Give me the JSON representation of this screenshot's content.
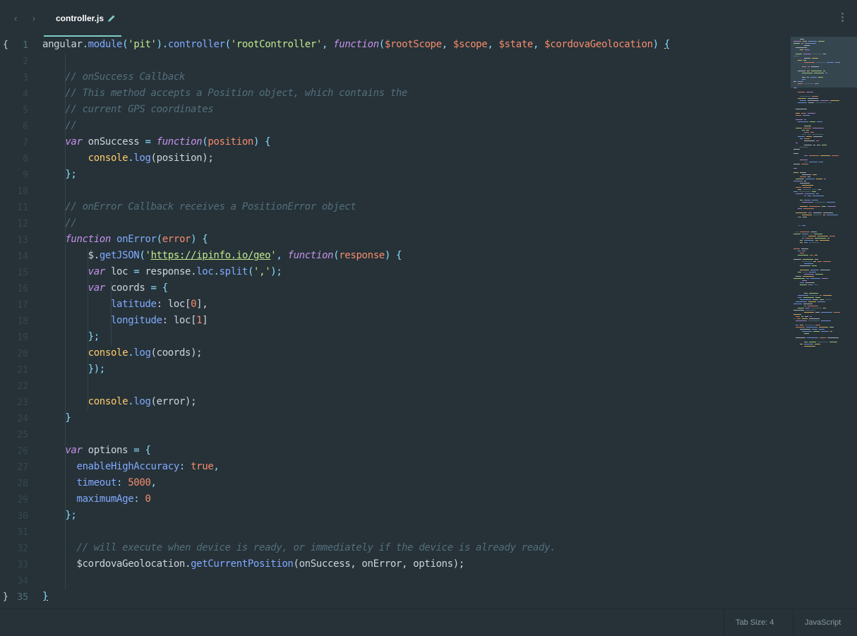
{
  "tab": {
    "filename": "controller.js"
  },
  "status": {
    "tab_size": "Tab Size: 4",
    "syntax": "JavaScript"
  },
  "colors": {
    "background": "#263238",
    "accent": "#80cbc4",
    "keyword": "#c792ea",
    "function": "#82aaff",
    "string": "#c3e88d",
    "comment": "#546e7a",
    "number": "#f78c6c",
    "constant": "#ffcb6b"
  },
  "icons": {
    "back": "chevron-left-icon",
    "forward": "chevron-right-icon",
    "edited": "pencil-icon",
    "menu": "more-vertical-icon"
  },
  "lines": [
    {
      "n": "1",
      "fold": "{",
      "t": [
        [
          "angular",
          "v"
        ],
        [
          ".",
          "p"
        ],
        [
          "module",
          "f"
        ],
        [
          "(",
          "p"
        ],
        [
          "'pit'",
          "s"
        ],
        [
          ")",
          "p"
        ],
        [
          ".",
          "p"
        ],
        [
          "controller",
          "f"
        ],
        [
          "(",
          "p"
        ],
        [
          "'rootController'",
          "s"
        ],
        [
          ", ",
          "p"
        ],
        [
          "function",
          "k"
        ],
        [
          "(",
          "p"
        ],
        [
          "$rootScope",
          "a"
        ],
        [
          ", ",
          "p"
        ],
        [
          "$scope",
          "a"
        ],
        [
          ", ",
          "p"
        ],
        [
          "$state",
          "a"
        ],
        [
          ", ",
          "p"
        ],
        [
          "$cordovaGeolocation",
          "a"
        ],
        [
          ") ",
          "p"
        ],
        [
          "{",
          "h"
        ]
      ]
    },
    {
      "n": "2",
      "t": []
    },
    {
      "n": "3",
      "t": [
        [
          "    ",
          "p"
        ],
        [
          "// onSuccess Callback",
          "c"
        ]
      ]
    },
    {
      "n": "4",
      "t": [
        [
          "    ",
          "p"
        ],
        [
          "// This method accepts a Position object, which contains the",
          "c"
        ]
      ]
    },
    {
      "n": "5",
      "t": [
        [
          "    ",
          "p"
        ],
        [
          "// current GPS coordinates",
          "c"
        ]
      ]
    },
    {
      "n": "6",
      "t": [
        [
          "    ",
          "p"
        ],
        [
          "//",
          "c"
        ]
      ]
    },
    {
      "n": "7",
      "t": [
        [
          "    ",
          "p"
        ],
        [
          "var",
          "k"
        ],
        [
          " onSuccess ",
          "v"
        ],
        [
          "= ",
          "p"
        ],
        [
          "function",
          "k"
        ],
        [
          "(",
          "p"
        ],
        [
          "position",
          "a"
        ],
        [
          ") {",
          "p"
        ]
      ]
    },
    {
      "n": "8",
      "t": [
        [
          "        ",
          "p"
        ],
        [
          "console",
          "y"
        ],
        [
          ".",
          "p"
        ],
        [
          "log",
          "f"
        ],
        [
          "(position);",
          "v"
        ]
      ]
    },
    {
      "n": "9",
      "t": [
        [
          "    ",
          "p"
        ],
        [
          "};",
          "p"
        ]
      ]
    },
    {
      "n": "10",
      "t": []
    },
    {
      "n": "11",
      "t": [
        [
          "    ",
          "p"
        ],
        [
          "// onError Callback receives a PositionError object",
          "c"
        ]
      ]
    },
    {
      "n": "12",
      "t": [
        [
          "    ",
          "p"
        ],
        [
          "//",
          "c"
        ]
      ]
    },
    {
      "n": "13",
      "t": [
        [
          "    ",
          "p"
        ],
        [
          "function",
          "k"
        ],
        [
          " onError",
          "f"
        ],
        [
          "(",
          "p"
        ],
        [
          "error",
          "a"
        ],
        [
          ") {",
          "p"
        ]
      ]
    },
    {
      "n": "14",
      "t": [
        [
          "        ",
          "p"
        ],
        [
          "$.",
          "v"
        ],
        [
          "getJSON",
          "f"
        ],
        [
          "(",
          "p"
        ],
        [
          "'",
          "s"
        ],
        [
          "https://ipinfo.io/geo",
          "u"
        ],
        [
          "'",
          "s"
        ],
        [
          ", ",
          "p"
        ],
        [
          "function",
          "k"
        ],
        [
          "(",
          "p"
        ],
        [
          "response",
          "a"
        ],
        [
          ") {",
          "p"
        ]
      ]
    },
    {
      "n": "15",
      "t": [
        [
          "        ",
          "p"
        ],
        [
          "var",
          "k"
        ],
        [
          " loc ",
          "v"
        ],
        [
          "= ",
          "p"
        ],
        [
          "response.",
          "v"
        ],
        [
          "loc",
          "f"
        ],
        [
          ".",
          "p"
        ],
        [
          "split",
          "f"
        ],
        [
          "(",
          "p"
        ],
        [
          "','",
          "s"
        ],
        [
          ");",
          "p"
        ]
      ]
    },
    {
      "n": "16",
      "t": [
        [
          "        ",
          "p"
        ],
        [
          "var",
          "k"
        ],
        [
          " coords ",
          "v"
        ],
        [
          "= {",
          "p"
        ]
      ]
    },
    {
      "n": "17",
      "t": [
        [
          "            ",
          "p"
        ],
        [
          "latitude",
          "f"
        ],
        [
          ": loc[",
          "v"
        ],
        [
          "0",
          "n"
        ],
        [
          "],",
          "v"
        ]
      ]
    },
    {
      "n": "18",
      "t": [
        [
          "            ",
          "p"
        ],
        [
          "longitude",
          "f"
        ],
        [
          ": loc[",
          "v"
        ],
        [
          "1",
          "n"
        ],
        [
          "]",
          "v"
        ]
      ]
    },
    {
      "n": "19",
      "t": [
        [
          "        ",
          "p"
        ],
        [
          "};",
          "p"
        ]
      ]
    },
    {
      "n": "20",
      "t": [
        [
          "        ",
          "p"
        ],
        [
          "console",
          "y"
        ],
        [
          ".",
          "p"
        ],
        [
          "log",
          "f"
        ],
        [
          "(coords);",
          "v"
        ]
      ]
    },
    {
      "n": "21",
      "t": [
        [
          "        ",
          "p"
        ],
        [
          "});",
          "p"
        ]
      ]
    },
    {
      "n": "22",
      "t": []
    },
    {
      "n": "23",
      "t": [
        [
          "        ",
          "p"
        ],
        [
          "console",
          "y"
        ],
        [
          ".",
          "p"
        ],
        [
          "log",
          "f"
        ],
        [
          "(error);",
          "v"
        ]
      ]
    },
    {
      "n": "24",
      "t": [
        [
          "    ",
          "p"
        ],
        [
          "}",
          "p"
        ]
      ]
    },
    {
      "n": "25",
      "t": []
    },
    {
      "n": "26",
      "t": [
        [
          "    ",
          "p"
        ],
        [
          "var",
          "k"
        ],
        [
          " options ",
          "v"
        ],
        [
          "= {",
          "p"
        ]
      ]
    },
    {
      "n": "27",
      "t": [
        [
          "      ",
          "p"
        ],
        [
          "enableHighAccuracy",
          "f"
        ],
        [
          ": ",
          "p"
        ],
        [
          "true",
          "n"
        ],
        [
          ",",
          "p"
        ]
      ]
    },
    {
      "n": "28",
      "t": [
        [
          "      ",
          "p"
        ],
        [
          "timeout",
          "f"
        ],
        [
          ": ",
          "p"
        ],
        [
          "5000",
          "n"
        ],
        [
          ",",
          "p"
        ]
      ]
    },
    {
      "n": "29",
      "t": [
        [
          "      ",
          "p"
        ],
        [
          "maximumAge",
          "f"
        ],
        [
          ": ",
          "p"
        ],
        [
          "0",
          "n"
        ]
      ]
    },
    {
      "n": "30",
      "t": [
        [
          "    ",
          "p"
        ],
        [
          "};",
          "p"
        ]
      ]
    },
    {
      "n": "31",
      "t": []
    },
    {
      "n": "32",
      "t": [
        [
          "      ",
          "p"
        ],
        [
          "// will execute when device is ready, or immediately if the device is already ready.",
          "c"
        ]
      ]
    },
    {
      "n": "33",
      "t": [
        [
          "      ",
          "p"
        ],
        [
          "$cordovaGeolocation.",
          "v"
        ],
        [
          "getCurrentPosition",
          "f"
        ],
        [
          "(onSuccess, onError, options);",
          "v"
        ]
      ]
    },
    {
      "n": "34",
      "t": []
    },
    {
      "n": "35",
      "fold": "}",
      "t": [
        [
          "}",
          "h"
        ]
      ]
    }
  ]
}
